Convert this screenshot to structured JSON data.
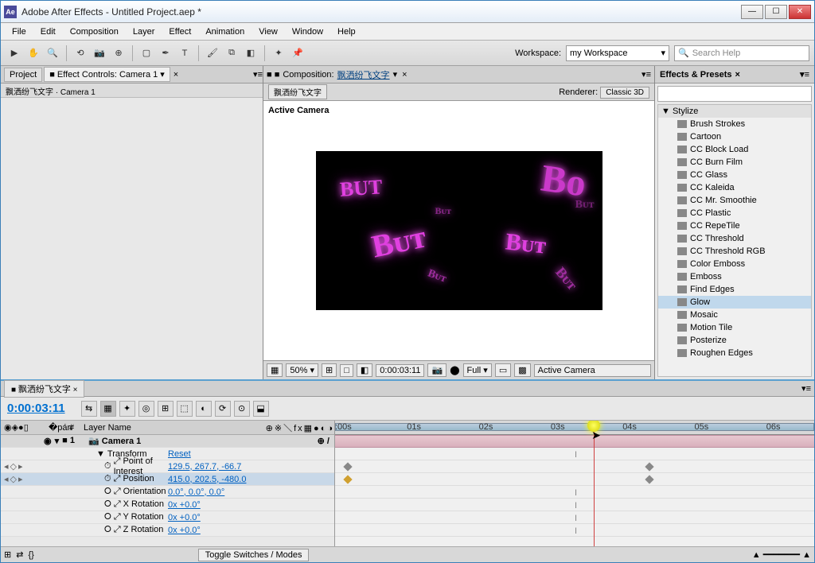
{
  "title": "Adobe After Effects - Untitled Project.aep *",
  "menu": [
    "File",
    "Edit",
    "Composition",
    "Layer",
    "Effect",
    "Animation",
    "View",
    "Window",
    "Help"
  ],
  "workspace": {
    "label": "Workspace:",
    "value": "my Workspace"
  },
  "search": {
    "placeholder": "Search Help"
  },
  "left_tabs": {
    "project": "Project",
    "fx": "Effect Controls: Camera 1"
  },
  "left_sub": "飘洒纷飞文字 · Camera 1",
  "comp": {
    "label": "Composition:",
    "name": "飘洒纷飞文字",
    "renderer_label": "Renderer:",
    "renderer": "Classic 3D",
    "active_cam": "Active Camera"
  },
  "viewer_footer": {
    "zoom": "50%",
    "time": "0:00:03:11",
    "res": "Full",
    "cam": "Active Camera"
  },
  "fx_panel": {
    "title": "Effects & Presets",
    "cat": "Stylize",
    "items": [
      "Brush Strokes",
      "Cartoon",
      "CC Block Load",
      "CC Burn Film",
      "CC Glass",
      "CC Kaleida",
      "CC Mr. Smoothie",
      "CC Plastic",
      "CC RepeTile",
      "CC Threshold",
      "CC Threshold RGB",
      "Color Emboss",
      "Emboss",
      "Find Edges",
      "Glow",
      "Mosaic",
      "Motion Tile",
      "Posterize",
      "Roughen Edges"
    ],
    "selected": "Glow"
  },
  "timeline": {
    "tab": "飘洒纷飞文字",
    "timecode": "0:00:03:11",
    "cols": {
      "layer_name": "Layer Name"
    },
    "layer": "Camera 1",
    "transform": "Transform",
    "reset": "Reset",
    "props": [
      {
        "name": "Point of Interest",
        "val": "129.5, 267.7, -66.7",
        "kf": true
      },
      {
        "name": "Position",
        "val": "415.0, 202.5, -480.0",
        "kf": true,
        "sel": true
      },
      {
        "name": "Orientation",
        "val": "0.0°, 0.0°, 0.0°"
      },
      {
        "name": "X Rotation",
        "val": "0x +0.0°"
      },
      {
        "name": "Y Rotation",
        "val": "0x +0.0°"
      },
      {
        "name": "Z Rotation",
        "val": "0x +0.0°"
      }
    ],
    "ruler": [
      ":00s",
      "01s",
      "02s",
      "03s",
      "04s",
      "05s",
      "06s"
    ],
    "toggle": "Toggle Switches / Modes"
  }
}
